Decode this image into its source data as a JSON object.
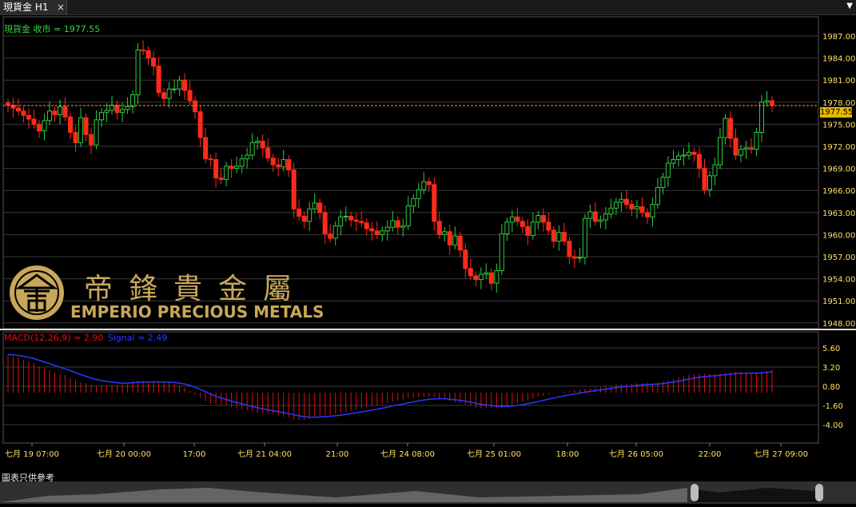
{
  "window": {
    "tab_title": "現貨金 H1",
    "close_glyph": "×",
    "menu_glyph": "▼"
  },
  "price_legend": "現貨金 收市 = 1977.55",
  "current_price": "1977.55",
  "macd_legend": {
    "macd": "MACD(12,26,9) = 2.90",
    "signal": "Signal = 2.49"
  },
  "footer_note": "圖表只供參考",
  "logo": {
    "cjk": "帝鋒貴金屬",
    "latin": "EMPERIO PRECIOUS METALS"
  },
  "colors": {
    "up": "#2ecc40",
    "down": "#ff2a1a",
    "grid": "#3a3a3a",
    "axis_text": "#ffe066",
    "macd": "#2a37ff",
    "hist": "#e01010",
    "price_line": "#ff9a2e",
    "logo": "#c9a75a"
  },
  "chart_data": {
    "type": "candlestick",
    "title": "現貨金 H1",
    "y_ticks": [
      "1987.00",
      "1984.00",
      "1981.00",
      "1978.00",
      "1975.00",
      "1972.00",
      "1969.00",
      "1966.00",
      "1963.00",
      "1960.00",
      "1957.00",
      "1954.00",
      "1951.00",
      "1948.00"
    ],
    "ylim": [
      1948,
      1987
    ],
    "x_ticks": [
      "七月 19 07:00",
      "七月 20 00:00",
      "17:00",
      "七月 21 04:00",
      "21:00",
      "七月 24 08:00",
      "七月 25 01:00",
      "18:00",
      "七月 26 05:00",
      "22:00",
      "七月 27 09:00"
    ],
    "close": [
      1977.6,
      1977.2,
      1976.8,
      1976.2,
      1975.7,
      1975.0,
      1974.1,
      1975.5,
      1976.8,
      1976.3,
      1977.4,
      1976.0,
      1973.9,
      1972.5,
      1975.9,
      1973.6,
      1972.2,
      1975.6,
      1976.6,
      1976.9,
      1977.6,
      1976.6,
      1977.0,
      1977.4,
      1979.0,
      1985.1,
      1985.0,
      1984.0,
      1982.9,
      1979.3,
      1978.5,
      1979.8,
      1979.8,
      1981.0,
      1979.6,
      1978.2,
      1976.7,
      1973.2,
      1970.3,
      1970.2,
      1967.7,
      1967.5,
      1969.3,
      1969.0,
      1969.3,
      1970.3,
      1970.8,
      1972.5,
      1972.7,
      1971.8,
      1970.4,
      1969.5,
      1969.2,
      1970.2,
      1968.8,
      1963.5,
      1962.5,
      1961.8,
      1963.5,
      1964.3,
      1963.0,
      1960.1,
      1959.5,
      1961.2,
      1962.4,
      1962.5,
      1962.0,
      1961.8,
      1961.6,
      1960.8,
      1960.5,
      1960.0,
      1960.5,
      1961.0,
      1961.9,
      1961.0,
      1961.2,
      1963.9,
      1964.9,
      1966.1,
      1967.2,
      1966.8,
      1961.8,
      1960.0,
      1960.4,
      1958.6,
      1959.8,
      1957.9,
      1955.4,
      1954.4,
      1953.9,
      1954.6,
      1954.8,
      1953.4,
      1955.1,
      1960.1,
      1961.7,
      1962.4,
      1961.8,
      1961.1,
      1959.9,
      1961.7,
      1962.6,
      1961.7,
      1960.6,
      1959.1,
      1960.3,
      1959.1,
      1957.0,
      1956.8,
      1956.9,
      1962.2,
      1963.1,
      1961.8,
      1962.0,
      1962.8,
      1963.6,
      1964.4,
      1964.8,
      1964.1,
      1963.5,
      1963.8,
      1963.0,
      1962.4,
      1964.1,
      1966.4,
      1967.8,
      1969.7,
      1970.2,
      1970.7,
      1970.8,
      1971.2,
      1970.9,
      1969.0,
      1966.1,
      1968.0,
      1969.5,
      1973.2,
      1975.8,
      1973.1,
      1970.8,
      1971.6,
      1971.8,
      1971.6,
      1973.9,
      1978.0,
      1978.2,
      1977.6
    ],
    "macd": [
      4.77,
      4.52,
      4.39,
      4.09,
      3.87,
      3.69,
      3.22,
      2.98,
      2.78,
      2.5,
      2.28,
      2.21,
      1.84,
      1.57,
      1.25,
      1.15,
      1.02,
      0.89,
      0.98,
      0.92,
      0.96,
      0.95,
      1.03,
      1.16,
      1.47,
      1.49,
      1.48,
      1.39,
      1.38,
      1.34,
      1.31,
      1.24,
      1.12,
      0.9,
      0.58,
      0.24,
      -0.28,
      -0.64,
      -1.05,
      -1.37,
      -1.48,
      -1.54,
      -1.62,
      -1.82,
      -2.0,
      -2.08,
      -2.24,
      -2.35,
      -2.53,
      -2.62,
      -2.63,
      -2.7,
      -2.86,
      -3.03,
      -3.09,
      -3.36,
      -3.42,
      -3.43,
      -3.28,
      -3.11,
      -2.89,
      -2.82,
      -2.76,
      -2.66,
      -2.51,
      -2.35,
      -2.25,
      -2.12,
      -1.96,
      -1.84,
      -1.72,
      -1.63,
      -1.45,
      -1.27,
      -1.12,
      -1.0,
      -0.94,
      -0.72,
      -0.63,
      -0.57,
      -0.48,
      -0.48,
      -0.51,
      -0.66,
      -0.81,
      -1.06,
      -1.17,
      -1.3,
      -1.48,
      -1.66,
      -1.86,
      -1.94,
      -1.93,
      -1.94,
      -1.95,
      -1.87,
      -1.75,
      -1.48,
      -1.29,
      -1.09,
      -0.95,
      -0.74,
      -0.52,
      -0.34,
      -0.22,
      -0.09,
      0.03,
      0.11,
      0.21,
      0.31,
      0.38,
      0.48,
      0.56,
      0.64,
      0.71,
      0.83,
      0.88,
      0.99,
      1.05,
      1.09,
      1.08,
      1.19,
      1.16,
      1.2,
      1.14,
      1.25,
      1.4,
      1.55,
      1.71,
      1.88,
      2.05,
      2.2,
      2.31,
      2.37,
      2.35,
      2.3,
      2.31,
      2.41,
      2.51,
      2.57,
      2.63,
      2.6,
      2.54,
      2.42,
      2.45,
      2.6,
      2.73,
      2.9
    ]
  }
}
